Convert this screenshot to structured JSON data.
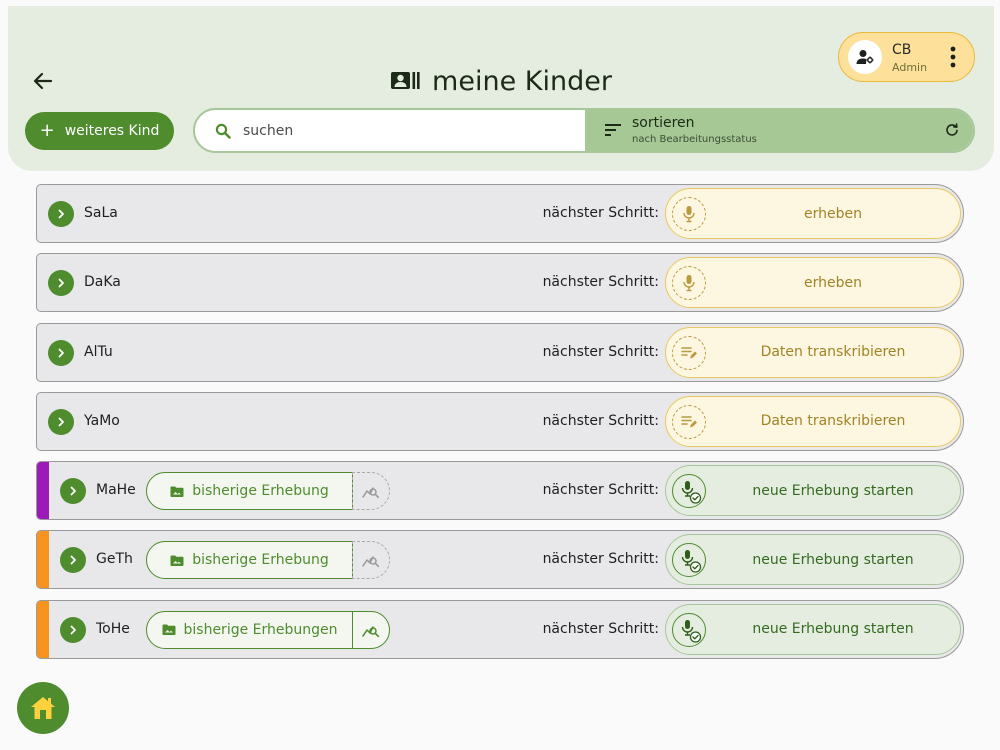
{
  "header": {
    "title": "meine Kinder",
    "user": {
      "initials": "CB",
      "role": "Admin"
    },
    "add_child_label": "weiteres Kind",
    "search": {
      "placeholder": "suchen"
    },
    "sort": {
      "title": "sortieren",
      "subtitle": "nach Bearbeitungsstatus"
    }
  },
  "colors": {
    "primary_green": "#4e8c2e",
    "header_bg": "#e5ede0",
    "sort_bg": "#a5c895",
    "user_chip": "#fde19a",
    "pending_action": "#fdf6e0",
    "flag_purple": "#9c1ab8",
    "flag_orange": "#f7931e"
  },
  "next_step_label": "nächster Schritt:",
  "children": [
    {
      "name": "SaLa",
      "flag": "",
      "previous": "",
      "analysis": "",
      "action": {
        "label": "erheben",
        "style": "yellow",
        "icon": "mic-icon"
      }
    },
    {
      "name": "DaKa",
      "flag": "",
      "previous": "",
      "analysis": "",
      "action": {
        "label": "erheben",
        "style": "yellow",
        "icon": "mic-icon"
      }
    },
    {
      "name": "AlTu",
      "flag": "",
      "previous": "",
      "analysis": "",
      "action": {
        "label": "Daten transkribieren",
        "style": "yellow",
        "icon": "transcribe-icon"
      }
    },
    {
      "name": "YaMo",
      "flag": "",
      "previous": "",
      "analysis": "",
      "action": {
        "label": "Daten transkribieren",
        "style": "yellow",
        "icon": "transcribe-icon"
      }
    },
    {
      "name": "MaHe",
      "flag": "#9c1ab8",
      "previous": "bisherige Erhebung",
      "analysis": "off",
      "action": {
        "label": "neue Erhebung starten",
        "style": "green",
        "icon": "mic-check-icon"
      }
    },
    {
      "name": "GeTh",
      "flag": "#f7931e",
      "previous": "bisherige Erhebung",
      "analysis": "off",
      "action": {
        "label": "neue Erhebung starten",
        "style": "green",
        "icon": "mic-check-icon"
      }
    },
    {
      "name": "ToHe",
      "flag": "#f7931e",
      "previous": "bisherige Erhebungen",
      "analysis": "on",
      "action": {
        "label": "neue Erhebung starten",
        "style": "green",
        "icon": "mic-check-icon"
      }
    }
  ]
}
